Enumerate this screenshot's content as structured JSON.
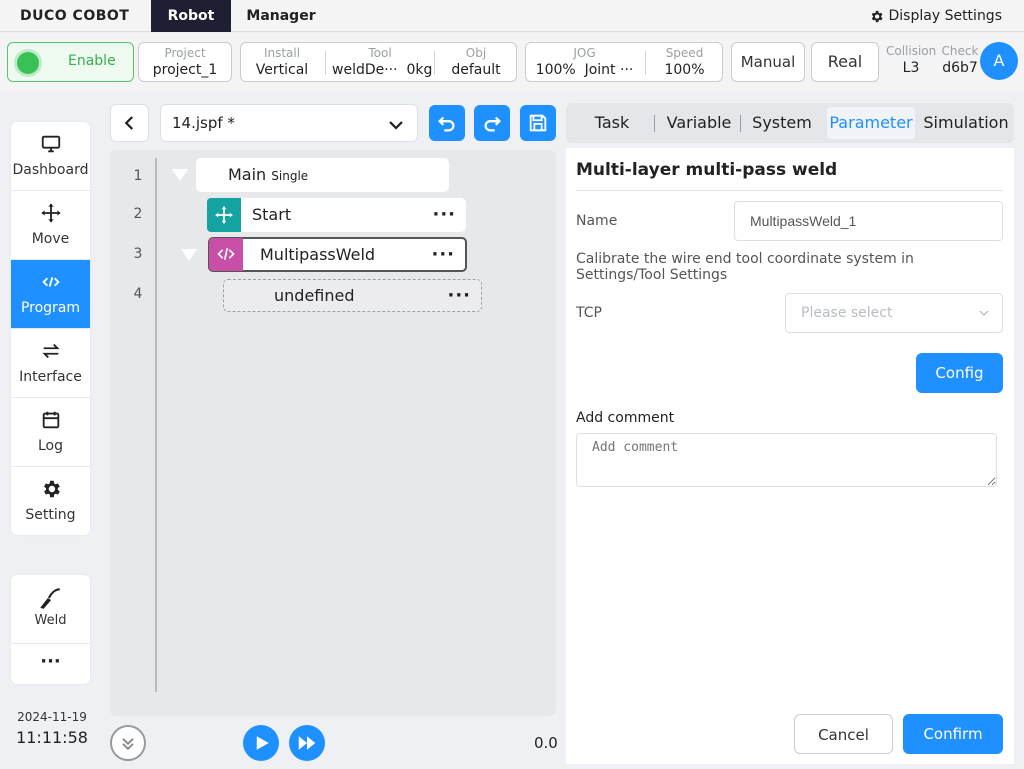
{
  "app": {
    "logo": "DUCO COBOT"
  },
  "top_tabs": [
    {
      "label": "Robot",
      "active": true
    },
    {
      "label": "Manager",
      "active": false
    }
  ],
  "display_settings": "Display Settings",
  "status": {
    "enable": "Enable",
    "project": {
      "caption": "Project",
      "value": "project_1"
    },
    "install": {
      "caption": "Install",
      "value": "Vertical"
    },
    "tool": {
      "caption": "Tool",
      "value": "weldDe···",
      "weight": "0kg"
    },
    "obj": {
      "caption": "Obj",
      "value": "default"
    },
    "jog": {
      "caption": "JOG",
      "percent": "100%",
      "mode": "Joint ···"
    },
    "speed": {
      "caption": "Speed",
      "value": "100%"
    },
    "manual": "Manual",
    "real": "Real",
    "collision": {
      "caption": "Collision",
      "value": "L3"
    },
    "check": {
      "caption": "Check",
      "value": "d6b7"
    },
    "avatar": "A"
  },
  "sidebar": {
    "items": [
      {
        "label": "Dashboard",
        "icon": "monitor-icon"
      },
      {
        "label": "Move",
        "icon": "move-arrows-icon"
      },
      {
        "label": "Program",
        "icon": "code-icon",
        "active": true
      },
      {
        "label": "Interface",
        "icon": "swap-arrows-icon"
      },
      {
        "label": "Log",
        "icon": "calendar-icon"
      },
      {
        "label": "Setting",
        "icon": "gear-icon"
      }
    ],
    "weld": "Weld",
    "more": "···"
  },
  "datetime": {
    "date": "2024-11-19",
    "time": "11:11:58"
  },
  "program": {
    "file": "14.jspf *",
    "lines": [
      "1",
      "2",
      "3",
      "4"
    ],
    "nodes": {
      "main": {
        "label": "Main",
        "mode": "Single"
      },
      "start": {
        "label": "Start"
      },
      "multipass": {
        "label": "MultipassWeld"
      },
      "child": {
        "label": "undefined"
      }
    },
    "more": "···",
    "speed_value": "0.0"
  },
  "right_tabs": [
    {
      "label": "Task"
    },
    {
      "label": "Variable"
    },
    {
      "label": "System"
    },
    {
      "label": "Parameter",
      "active": true
    },
    {
      "label": "Simulation"
    }
  ],
  "form": {
    "title": "Multi-layer multi-pass weld",
    "name_label": "Name",
    "name_value": "MultipassWeld_1",
    "hint": "Calibrate the wire end tool coordinate system in Settings/Tool Settings",
    "tcp_label": "TCP",
    "tcp_placeholder": "Please select",
    "config": "Config",
    "comment_label": "Add comment",
    "comment_placeholder": "Add comment",
    "cancel": "Cancel",
    "confirm": "Confirm"
  },
  "colors": {
    "accent": "#1e90ff",
    "enable_green": "#38c255",
    "teal": "#14a3a0",
    "magenta": "#c84fa8",
    "topbar_dark": "#1f1f33"
  }
}
